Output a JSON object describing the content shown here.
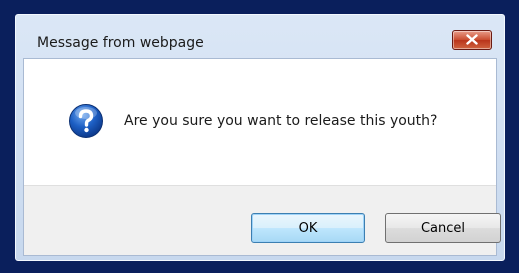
{
  "dialog": {
    "title": "Message from webpage",
    "message": "Are you sure you want to release this youth?",
    "icon": "question-icon",
    "buttons": {
      "ok_label": "OK",
      "cancel_label": "Cancel"
    }
  },
  "colors": {
    "background": "#0a1f5c",
    "close_button": "#c94b2e",
    "ok_focus_border": "#3c7fb1"
  }
}
